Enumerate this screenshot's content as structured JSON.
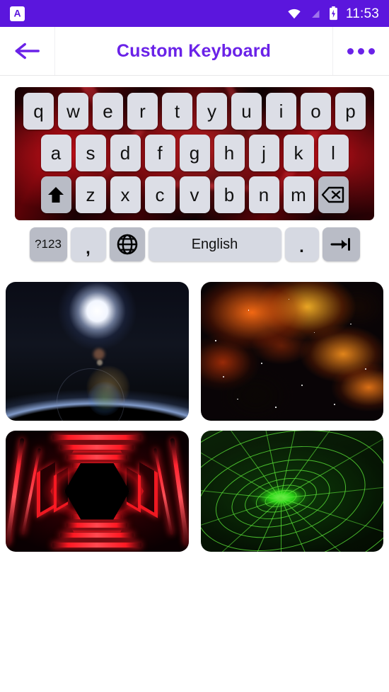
{
  "status_bar": {
    "background_color": "#5b16dd",
    "notification_icon": "app-letter-a-icon",
    "notification_letter": "A",
    "wifi_icon": "wifi-icon",
    "signal_icon": "signal-icon",
    "battery_icon": "battery-charging-icon",
    "time": "11:53"
  },
  "app_bar": {
    "background_color": "#ffffff",
    "accent_color": "#6a22e8",
    "back_icon": "back-arrow-icon",
    "title": "Custom Keyboard",
    "overflow_icon": "more-options-icon"
  },
  "keyboard_preview": {
    "theme_name": "red-lightning",
    "row1": [
      "q",
      "w",
      "e",
      "r",
      "t",
      "y",
      "u",
      "i",
      "o",
      "p"
    ],
    "row2": [
      "a",
      "s",
      "d",
      "f",
      "g",
      "h",
      "j",
      "k",
      "l"
    ],
    "row3_shift_icon": "shift-arrow-icon",
    "row3": [
      "z",
      "x",
      "c",
      "v",
      "b",
      "n",
      "m"
    ],
    "row3_backspace_icon": "backspace-icon",
    "bottom_row": {
      "symbols_label": "?123",
      "comma_label": ",",
      "globe_icon": "globe-language-icon",
      "space_label": "English",
      "period_label": ".",
      "enter_icon": "tab-arrow-icon"
    }
  },
  "theme_grid": {
    "items": [
      {
        "name": "earth-sunrise-theme",
        "style": "th-earth"
      },
      {
        "name": "orange-nebula-theme",
        "style": "th-nebula"
      },
      {
        "name": "red-neon-tunnel-theme",
        "style": "th-redtunnel"
      },
      {
        "name": "green-vortex-grid-theme",
        "style": "th-vortex"
      }
    ]
  }
}
